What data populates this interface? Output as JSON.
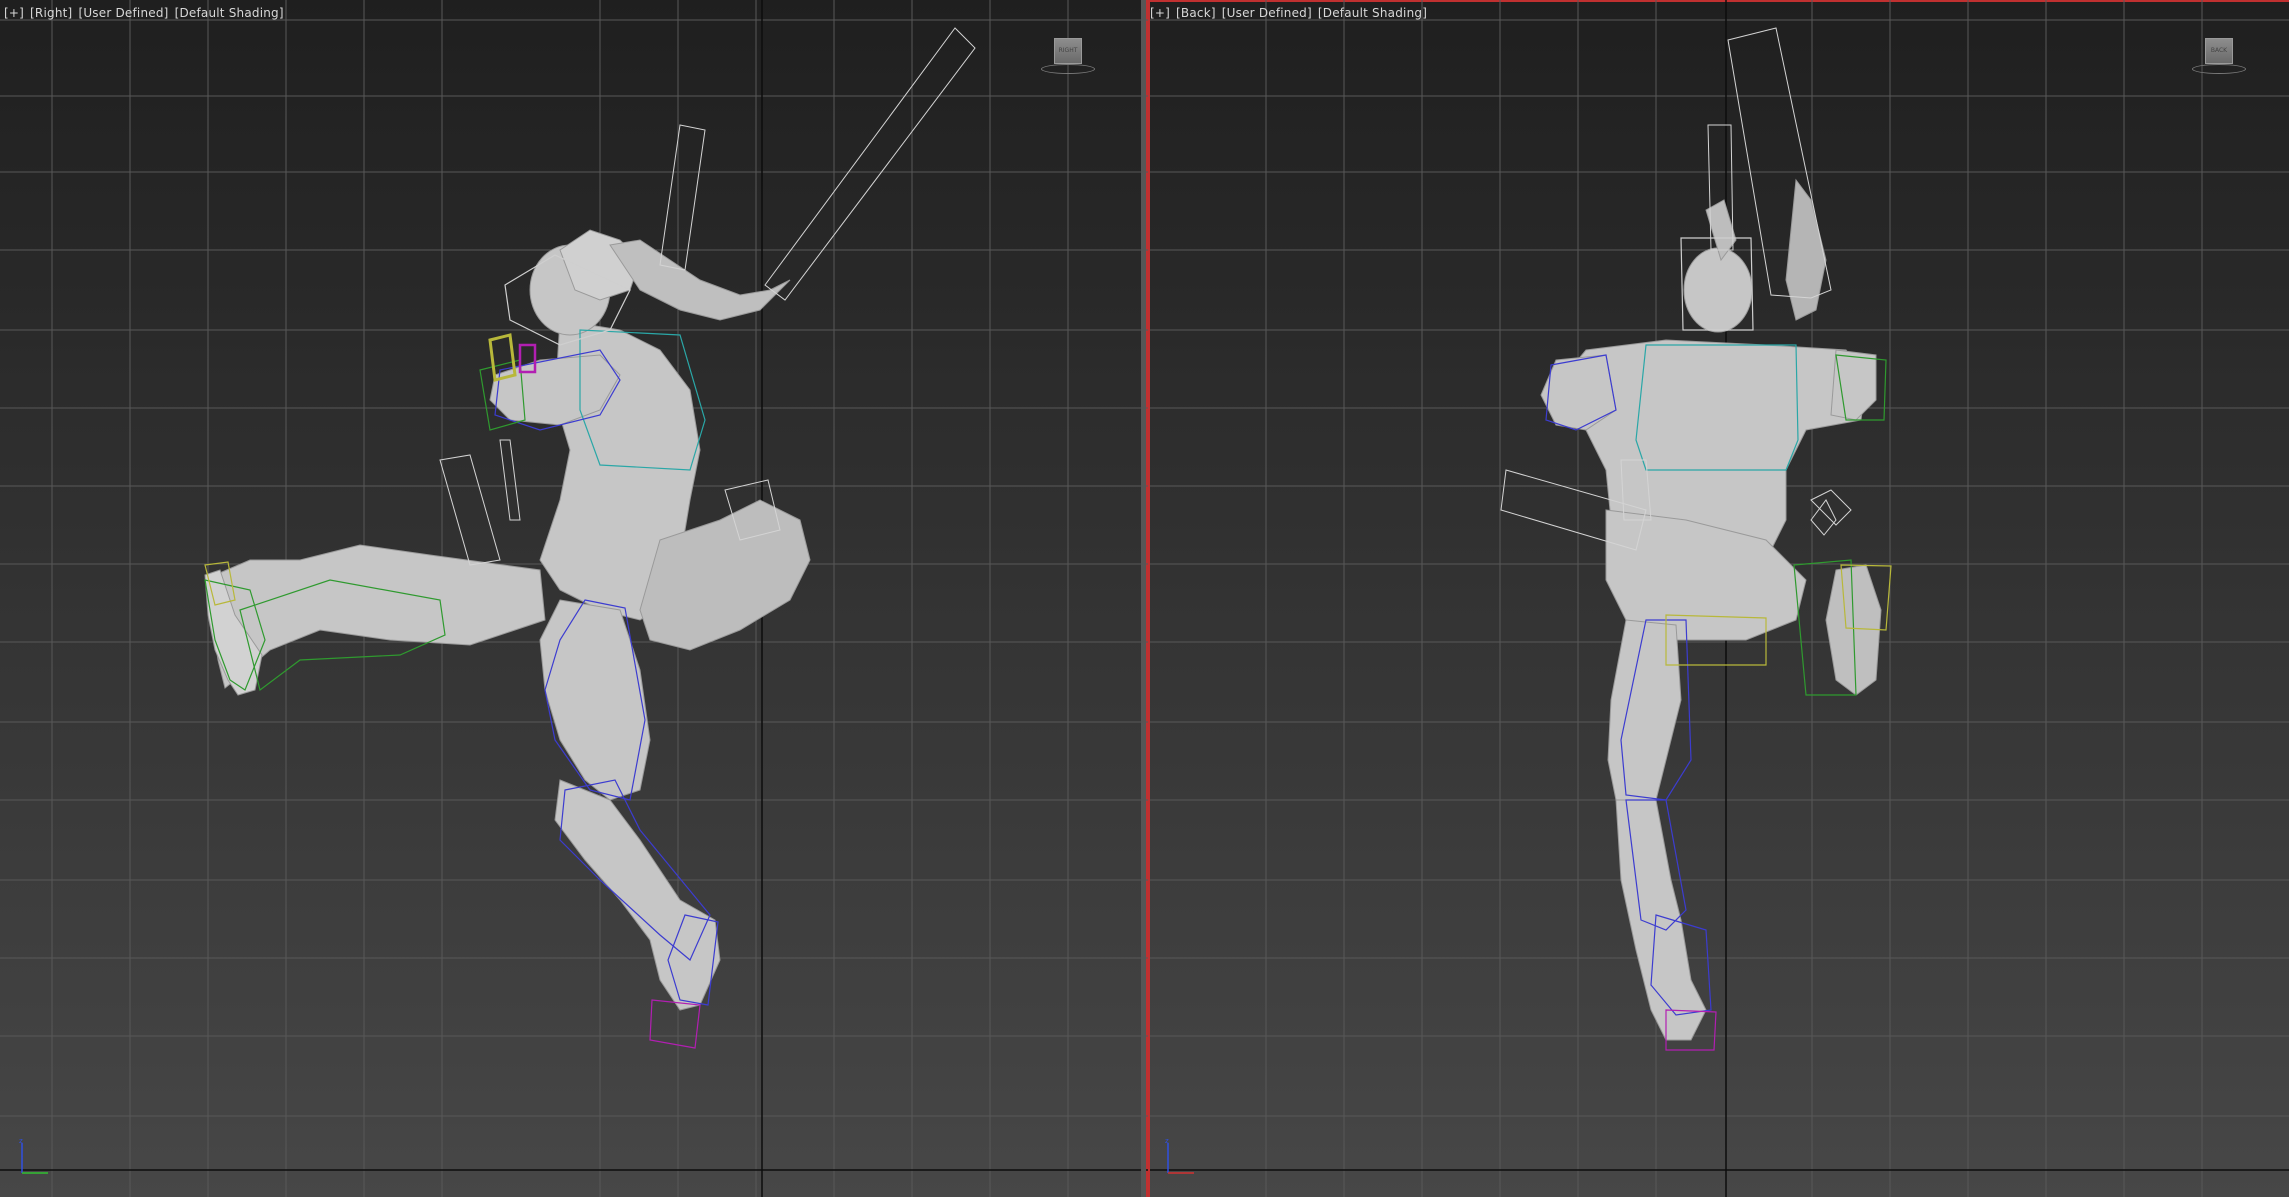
{
  "viewports": [
    {
      "id": "right",
      "label_menu": "[+]",
      "label_view": "[Right]",
      "label_camera": "[User Defined]",
      "label_shading": "[Default Shading]",
      "viewcube_face": "RIGHT",
      "active": false
    },
    {
      "id": "back",
      "label_menu": "[+]",
      "label_view": "[Back]",
      "label_camera": "[User Defined]",
      "label_shading": "[Default Shading]",
      "viewcube_face": "BACK",
      "active": true
    }
  ],
  "colors": {
    "grid": "#5a5a5a",
    "grid_axis": "#0c0c0c",
    "mesh": "#c9c9c9",
    "mesh_shadow": "#8e8e8e",
    "bone_blue": "#3c3cd0",
    "bone_green": "#2f9a2f",
    "bone_cyan": "#2aa7a7",
    "bone_yellow": "#b8b83a",
    "bone_magenta": "#b21fb2",
    "helper_white": "#d8d8d8",
    "active_border": "#c03030",
    "axis_x": "#d03030",
    "axis_y": "#30c030",
    "axis_z": "#3050e0"
  },
  "icons": {
    "viewcube": "viewcube-icon",
    "tripod": "axis-tripod-icon"
  }
}
